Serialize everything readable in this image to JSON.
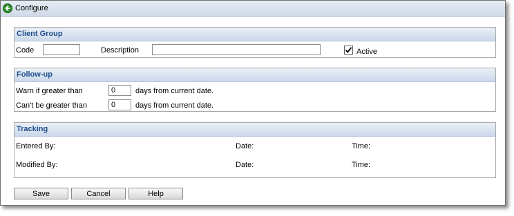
{
  "window": {
    "title": "Configure",
    "back_icon": "back-arrow-icon"
  },
  "client_group": {
    "header": "Client Group",
    "code_label": "Code",
    "code_value": "",
    "description_label": "Description",
    "description_value": "",
    "active_label": "Active",
    "active_checked": true
  },
  "follow_up": {
    "header": "Follow-up",
    "warn_label": "Warn if greater than",
    "warn_value": "0",
    "warn_suffix": "days from current date.",
    "max_label": "Can't be greater than",
    "max_value": "0",
    "max_suffix": "days from current date."
  },
  "tracking": {
    "header": "Tracking",
    "entered_by_label": "Entered By:",
    "entered_date_label": "Date:",
    "entered_time_label": "Time:",
    "modified_by_label": "Modified By:",
    "modified_date_label": "Date:",
    "modified_time_label": "Time:"
  },
  "buttons": {
    "save": "Save",
    "cancel": "Cancel",
    "help": "Help"
  },
  "colors": {
    "section_header_text": "#1f4e8c",
    "icon_green": "#2e8b2e"
  }
}
